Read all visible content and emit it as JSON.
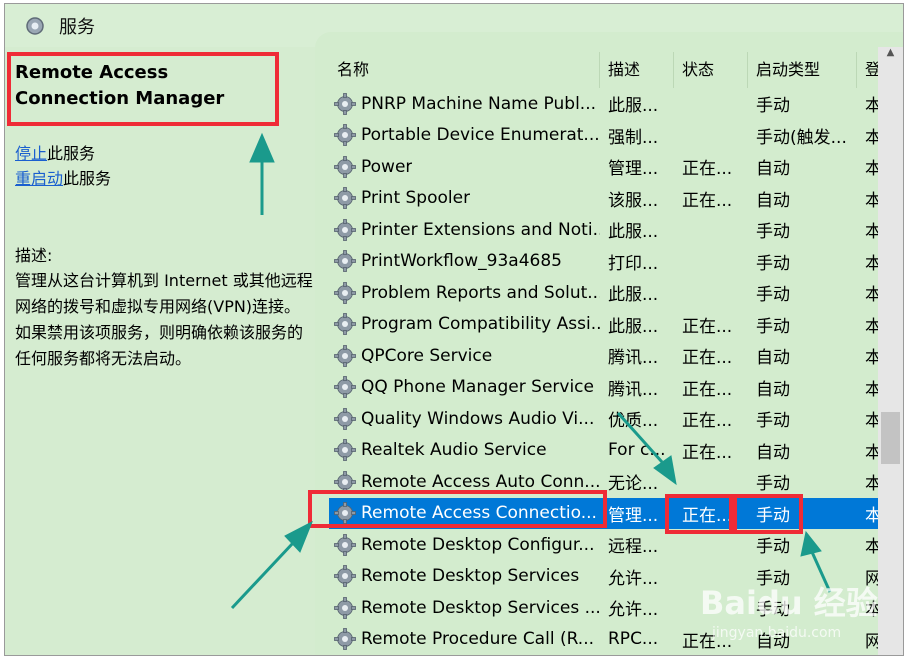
{
  "window": {
    "title": "服务"
  },
  "left": {
    "service_name": "Remote Access Connection Manager",
    "stop_link": "停止",
    "stop_suffix": "此服务",
    "restart_link": "重启动",
    "restart_suffix": "此服务",
    "desc_label": "描述:",
    "description": "管理从这台计算机到 Internet 或其他远程网络的拨号和虚拟专用网络(VPN)连接。如果禁用该项服务，则明确依赖该服务的任何服务都将无法启动。"
  },
  "columns": {
    "name": "名称",
    "desc": "描述",
    "status": "状态",
    "startup": "启动类型",
    "logon": "登"
  },
  "rows": [
    {
      "name": "PNRP Machine Name Publ...",
      "desc": "此服...",
      "status": "",
      "startup": "手动",
      "logon": "本"
    },
    {
      "name": "Portable Device Enumerat...",
      "desc": "强制...",
      "status": "",
      "startup": "手动(触发...",
      "logon": "本"
    },
    {
      "name": "Power",
      "desc": "管理...",
      "status": "正在...",
      "startup": "自动",
      "logon": "本"
    },
    {
      "name": "Print Spooler",
      "desc": "该服...",
      "status": "正在...",
      "startup": "自动",
      "logon": "本"
    },
    {
      "name": "Printer Extensions and Noti...",
      "desc": "此服...",
      "status": "",
      "startup": "手动",
      "logon": "本"
    },
    {
      "name": "PrintWorkflow_93a4685",
      "desc": "打印...",
      "status": "",
      "startup": "手动",
      "logon": "本"
    },
    {
      "name": "Problem Reports and Solut...",
      "desc": "此服...",
      "status": "",
      "startup": "手动",
      "logon": "本"
    },
    {
      "name": "Program Compatibility Assi...",
      "desc": "此服...",
      "status": "正在...",
      "startup": "手动",
      "logon": "本"
    },
    {
      "name": "QPCore Service",
      "desc": "腾讯...",
      "status": "正在...",
      "startup": "自动",
      "logon": "本"
    },
    {
      "name": "QQ Phone Manager Service",
      "desc": "腾讯...",
      "status": "正在...",
      "startup": "自动",
      "logon": "本"
    },
    {
      "name": "Quality Windows Audio Vi...",
      "desc": "优质...",
      "status": "正在...",
      "startup": "手动",
      "logon": "本"
    },
    {
      "name": "Realtek Audio Service",
      "desc": "For c...",
      "status": "正在...",
      "startup": "自动",
      "logon": "本"
    },
    {
      "name": "Remote Access Auto Conn...",
      "desc": "无论...",
      "status": "",
      "startup": "手动",
      "logon": "本"
    },
    {
      "name": "Remote Access Connectio...",
      "desc": "管理...",
      "status": "正在...",
      "startup": "手动",
      "logon": "本",
      "selected": true
    },
    {
      "name": "Remote Desktop Configur...",
      "desc": "远程...",
      "status": "",
      "startup": "手动",
      "logon": "本"
    },
    {
      "name": "Remote Desktop Services",
      "desc": "允许...",
      "status": "",
      "startup": "手动",
      "logon": "网"
    },
    {
      "name": "Remote Desktop Services ...",
      "desc": "允许...",
      "status": "",
      "startup": "手动",
      "logon": "本"
    },
    {
      "name": "Remote Procedure Call (R...",
      "desc": "RPC...",
      "status": "正在...",
      "startup": "自动",
      "logon": "网"
    }
  ],
  "watermark": {
    "main": "Baidu 经验",
    "sub": "jingyan.baidu.com"
  },
  "colors": {
    "selection": "#0078d7",
    "highlight": "#ef2b36",
    "arrow": "#1a9a8c",
    "background": "#d5ecd0"
  }
}
